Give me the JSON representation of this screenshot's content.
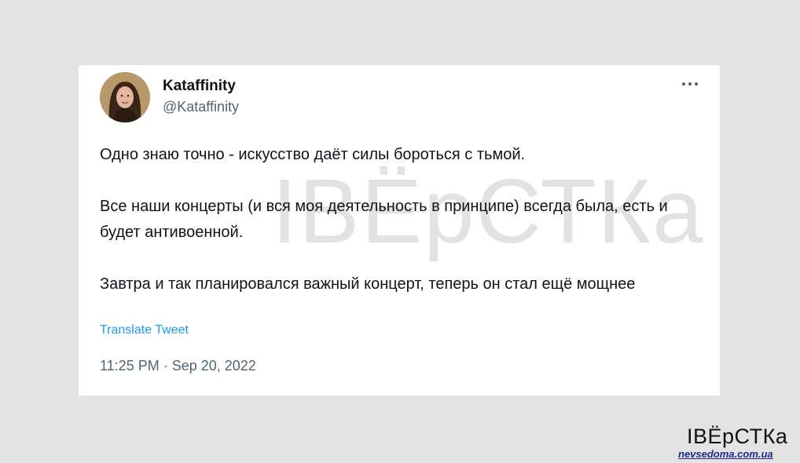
{
  "tweet": {
    "author_name": "Kataffinity",
    "author_handle": "@Kataffinity",
    "avatar_icon": "profile-photo",
    "more_icon": "more-options-icon",
    "paragraphs": [
      "Одно знаю точно - искусство даёт силы бороться с тьмой.",
      "Все наши концерты (и вся моя деятельность в принципе) всегда была, есть и будет антивоенной.",
      "Завтра и так планировался важный концерт, теперь он стал ещё мощнее"
    ],
    "translate_label": "Translate Tweet",
    "timestamp": "11:25 PM · Sep 20, 2022"
  },
  "watermark": {
    "text": "IВЁрСТКа"
  },
  "brand": {
    "logo_text": "IВЁрСТКа",
    "source_url": "nevsedoma.com.ua"
  },
  "colors": {
    "background": "#e3e3e3",
    "card": "#ffffff",
    "text_primary": "#0f1419",
    "text_secondary": "#536471",
    "link": "#1d9bf0",
    "watermark": "#e2e2e2",
    "source_url": "#1b2a8a"
  }
}
